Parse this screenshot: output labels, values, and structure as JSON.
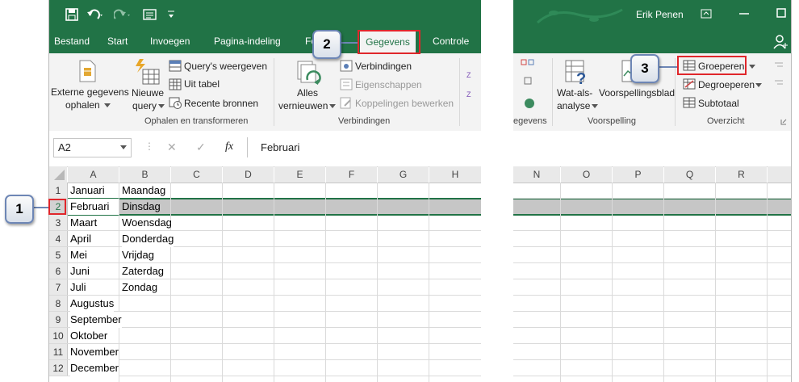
{
  "window": {
    "user": "Erik Penen"
  },
  "tabs": [
    "Bestand",
    "Start",
    "Invoegen",
    "Pagina-indeling",
    "Fo",
    "Gegevens",
    "Controle"
  ],
  "ribbon_left": {
    "external_data": [
      "Externe gegevens",
      "ophalen"
    ],
    "new_query": [
      "Nieuwe",
      "query"
    ],
    "show_queries": "Query's weergeven",
    "from_table": "Uit tabel",
    "recent_sources": "Recente bronnen",
    "refresh_all": [
      "Alles",
      "vernieuwen"
    ],
    "connections": "Verbindingen",
    "properties": "Eigenschappen",
    "edit_links": "Koppelingen bewerken",
    "group_get_transform": "Ophalen en transformeren",
    "group_connections": "Verbindingen"
  },
  "ribbon_right": {
    "what_if": [
      "Wat-als-",
      "analyse"
    ],
    "forecast_sheet": "Voorspellingsblad",
    "group_button": "Groeperen",
    "ungroup_button": "Degroeperen",
    "subtotal_button": "Subtotaal",
    "group_data_tools": "egevens",
    "group_forecast": "Voorspelling",
    "group_outline": "Overzicht"
  },
  "formula_bar": {
    "name_box": "A2",
    "cancel": "✕",
    "enter": "✓",
    "fx": "fx",
    "value": "Februari"
  },
  "columns_left": [
    "A",
    "B",
    "C",
    "D",
    "E",
    "F",
    "G",
    "H"
  ],
  "columns_right": [
    "N",
    "O",
    "P",
    "Q",
    "R"
  ],
  "rows": [
    {
      "n": "1",
      "a": "Januari",
      "b": "Maandag"
    },
    {
      "n": "2",
      "a": "Februari",
      "b": "Dinsdag"
    },
    {
      "n": "3",
      "a": "Maart",
      "b": "Woensdag"
    },
    {
      "n": "4",
      "a": "April",
      "b": "Donderdag"
    },
    {
      "n": "5",
      "a": "Mei",
      "b": "Vrijdag"
    },
    {
      "n": "6",
      "a": "Juni",
      "b": "Zaterdag"
    },
    {
      "n": "7",
      "a": "Juli",
      "b": "Zondag"
    },
    {
      "n": "8",
      "a": "Augustus",
      "b": ""
    },
    {
      "n": "9",
      "a": "September",
      "b": ""
    },
    {
      "n": "10",
      "a": "Oktober",
      "b": ""
    },
    {
      "n": "11",
      "a": "November",
      "b": ""
    },
    {
      "n": "12",
      "a": "December",
      "b": ""
    }
  ],
  "callouts": [
    "1",
    "2",
    "3"
  ],
  "colors": {
    "excel_green": "#217346",
    "highlight_red": "#e0262b",
    "callout_border": "#6d86b5",
    "selected_row": "#c6c6c6"
  }
}
